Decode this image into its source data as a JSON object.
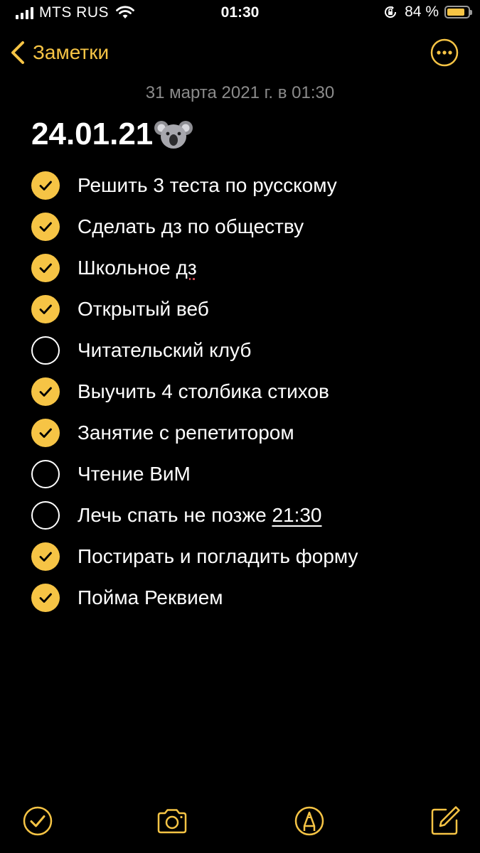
{
  "status_bar": {
    "carrier": "MTS RUS",
    "time": "01:30",
    "battery_percent": "84 %",
    "battery_level": 0.84,
    "icons": [
      "signal-icon",
      "wifi-icon",
      "rotation-lock-icon",
      "battery-icon"
    ]
  },
  "nav": {
    "back_label": "Заметки",
    "icons": [
      "chevron-left-icon",
      "more-icon"
    ]
  },
  "note": {
    "date": "31 марта 2021 г. в 01:30",
    "title": "24.01.21",
    "title_emoji_icon": "koala-icon",
    "items": [
      {
        "text": "Решить 3 теста по русскому",
        "checked": true
      },
      {
        "pre": "Сделать дз по обществу",
        "checked": true
      },
      {
        "pre": "Школьное ",
        "spell": "дз",
        "checked": true
      },
      {
        "pre": "Открытый веб",
        "checked": true
      },
      {
        "pre": "Читательский клуб",
        "checked": false
      },
      {
        "pre": "Выучить 4 столбика стихов",
        "checked": true
      },
      {
        "pre": "Занятие с репетитором",
        "checked": true
      },
      {
        "pre": "Чтение ВиМ",
        "checked": false
      },
      {
        "pre": "Лечь спать не позже ",
        "link": "21:30",
        "checked": false
      },
      {
        "pre": "Постирать и погладить форму",
        "checked": true
      },
      {
        "pre": "Пойма Реквием",
        "checked": true
      }
    ]
  },
  "toolbar": {
    "icons": [
      "checklist-icon",
      "camera-icon",
      "markup-icon",
      "compose-icon"
    ]
  },
  "colors": {
    "accent": "#f6c445",
    "background": "#000000",
    "date_text": "#8b8b8b",
    "text": "#ffffff"
  }
}
